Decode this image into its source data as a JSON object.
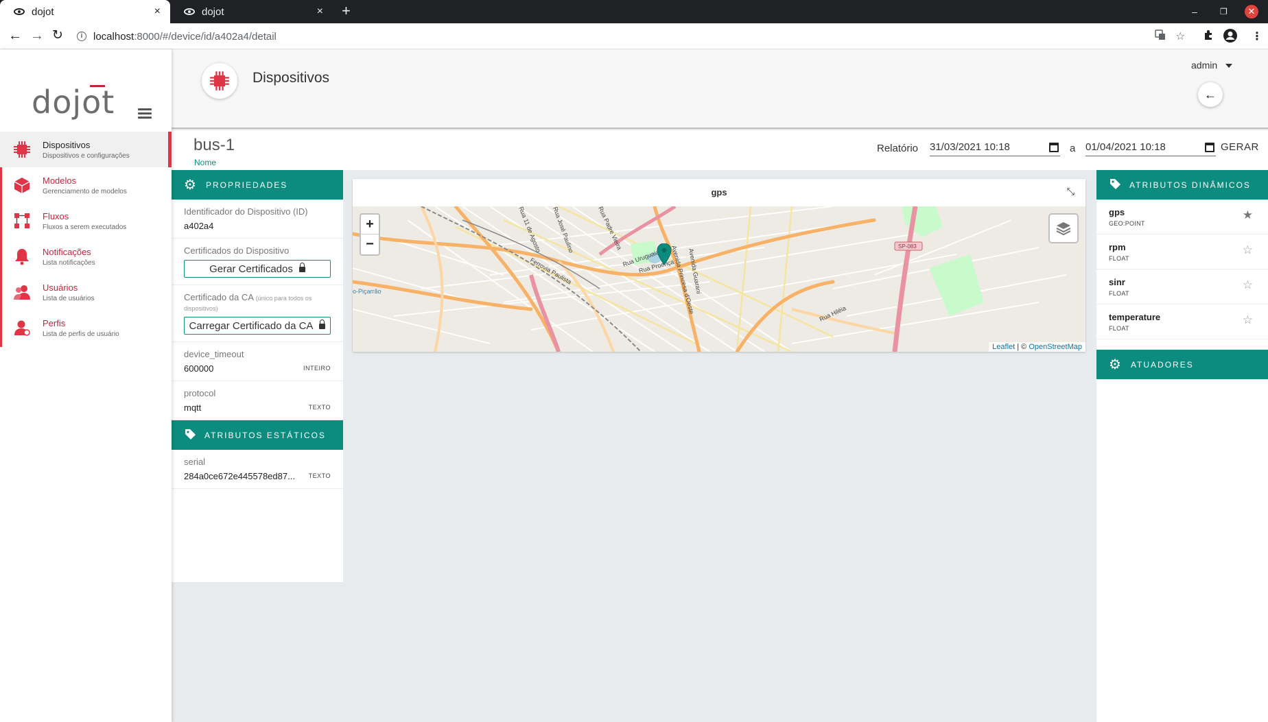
{
  "browser": {
    "tabs": [
      {
        "title": "dojot",
        "active": true
      },
      {
        "title": "dojot",
        "active": false
      }
    ],
    "new_tab": "+",
    "close_tab": "×",
    "url_host": "localhost",
    "url_path": ":8000/#/device/id/a402a4/detail",
    "win_min": "–",
    "win_max": "❐",
    "win_close": "✕"
  },
  "sidebar": {
    "logo": "dojot",
    "items": [
      {
        "title": "Dispositivos",
        "subtitle": "Dispositivos e configurações",
        "icon": "chip-icon",
        "active": true
      },
      {
        "title": "Modelos",
        "subtitle": "Gerenciamento de modelos",
        "icon": "cube-icon",
        "active": false
      },
      {
        "title": "Fluxos",
        "subtitle": "Fluxos a serem executados",
        "icon": "flow-icon",
        "active": false
      },
      {
        "title": "Notificações",
        "subtitle": "Lista notificações",
        "icon": "bell-icon",
        "active": false
      },
      {
        "title": "Usuários",
        "subtitle": "Lista de usuários",
        "icon": "users-icon",
        "active": false
      },
      {
        "title": "Perfis",
        "subtitle": "Lista de perfis de usuário",
        "icon": "profile-icon",
        "active": false
      }
    ]
  },
  "header": {
    "title": "Dispositivos",
    "user": "admin",
    "back_icon": "arrow-left-icon"
  },
  "device": {
    "name": "bus-1",
    "name_label": "Nome"
  },
  "report": {
    "label": "Relatório",
    "from_date": "31/03/2021",
    "from_time": "10:18",
    "separator": "a",
    "to_date": "01/04/2021",
    "to_time": "10:18",
    "generate": "GERAR"
  },
  "properties": {
    "header": "PROPRIEDADES",
    "id_label": "Identificador do Dispositivo (ID)",
    "id_value": "a402a4",
    "cert_label": "Certificados do Dispositivo",
    "cert_button": "Gerar Certificados",
    "ca_label": "Certificado da CA",
    "ca_note": "(único para todos os dispositivos)",
    "ca_button": "Carregar Certificado da CA",
    "attrs": [
      {
        "name": "device_timeout",
        "value": "600000",
        "type": "INTEIRO"
      },
      {
        "name": "protocol",
        "value": "mqtt",
        "type": "TEXTO"
      }
    ]
  },
  "static_attrs": {
    "header": "ATRIBUTOS ESTÁTICOS",
    "items": [
      {
        "name": "serial",
        "value": "284a0ce672e445578ed87...",
        "type": "TEXTO"
      }
    ]
  },
  "map": {
    "title": "gps",
    "zoom_in": "+",
    "zoom_out": "−",
    "attribution_leaflet": "Leaflet",
    "attribution_sep": " | © ",
    "attribution_osm": "OpenStreetMap",
    "labels": [
      "Rua Uruguaiana",
      "Rua Proença",
      "Avenida Princesa d'Oeste",
      "Avenida Guarani",
      "Ferrovia Paulista",
      "Rua Padre Vieira",
      "Rua José Paulino",
      "Rua 11 de Agosto",
      "Rua Hiléia",
      "SP-083",
      "o-Piçarrão"
    ],
    "colors": {
      "water": "#aad3df",
      "park": "#c8facc",
      "major_road": "#f7b267",
      "primary": "#fcd6a4",
      "highway": "#e892a2",
      "minor": "#ffffff",
      "rail": "#8a8a8a",
      "marker": "#0c8c7e"
    }
  },
  "dynamic_attrs": {
    "header": "ATRIBUTOS DINÂMICOS",
    "items": [
      {
        "name": "gps",
        "type": "GEO:POINT",
        "starred": true
      },
      {
        "name": "rpm",
        "type": "FLOAT",
        "starred": false
      },
      {
        "name": "sinr",
        "type": "FLOAT",
        "starred": false
      },
      {
        "name": "temperature",
        "type": "FLOAT",
        "starred": false
      }
    ]
  },
  "actuators": {
    "header": "ATUADORES"
  },
  "theme": {
    "accent": "#0c8c7e",
    "brand_red": "#c4243b"
  }
}
